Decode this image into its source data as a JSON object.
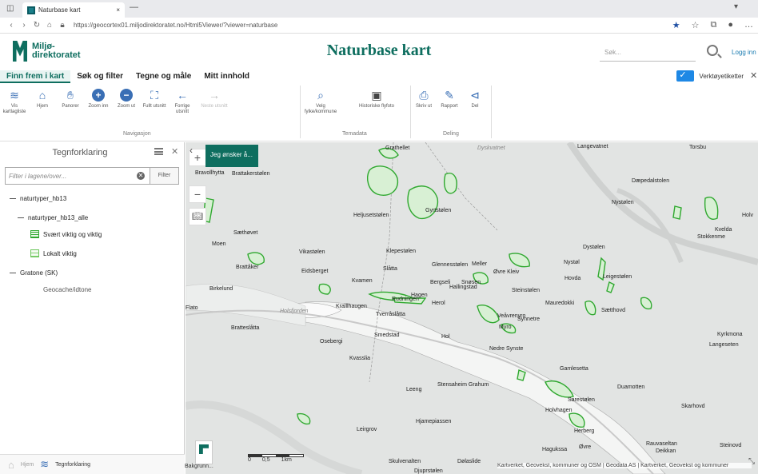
{
  "browser": {
    "tab_title": "Naturbase kart",
    "tab_close": "×",
    "new_tab": "—",
    "url": "https://geocortex01.miljodirektoratet.no/Html5Viewer/?viewer=naturbase"
  },
  "header": {
    "logo_line1": "Miljø-",
    "logo_line2": "direktoratet",
    "title": "Naturbase kart",
    "search_placeholder": "Søk...",
    "login": "Logg inn"
  },
  "ribbon_tabs": [
    {
      "label": "Finn frem i kart"
    },
    {
      "label": "Søk og filter"
    },
    {
      "label": "Tegne og måle"
    },
    {
      "label": "Mitt innhold"
    }
  ],
  "toggle_label": "Verktøyetiketter",
  "ribbon": {
    "navigation": [
      {
        "label": "Vis kartlagliste",
        "icon": "layers-icon"
      },
      {
        "label": "Hjem",
        "icon": "home-icon"
      },
      {
        "label": "Panorer",
        "icon": "pan-icon"
      },
      {
        "label": "Zoom inn",
        "icon": "zoom-in-icon"
      },
      {
        "label": "Zoom ut",
        "icon": "zoom-out-icon"
      },
      {
        "label": "Fullt utsnitt",
        "icon": "full-extent-icon"
      },
      {
        "label": "Forrige utsnitt",
        "icon": "previous-extent-icon"
      },
      {
        "label": "Neste utsnitt",
        "icon": "next-extent-icon"
      }
    ],
    "navigation_group": "Navigasjon",
    "tools": [
      {
        "label": "Velg fylke/kommune",
        "icon": "select-area-icon"
      },
      {
        "label": "Historiske flyfoto",
        "icon": "historic-photo-icon"
      }
    ],
    "tools_group": "Temadata",
    "share": [
      {
        "label": "Skriv ut",
        "icon": "print-icon"
      },
      {
        "label": "Rapport",
        "icon": "report-icon"
      },
      {
        "label": "Del",
        "icon": "share-icon"
      }
    ],
    "share_group": "Deling"
  },
  "panel": {
    "title": "Tegnforklaring",
    "filter_placeholder": "Filter i lagene/over...",
    "filter_button": "Filter",
    "tree": [
      {
        "label": "naturtyper_hb13"
      },
      {
        "label": "naturtyper_hb13_alle"
      },
      {
        "label": "Svært viktig og viktig"
      },
      {
        "label": "Lokalt viktig"
      },
      {
        "label": "Gratone (SK)"
      },
      {
        "label": "Geocache/idtone"
      }
    ],
    "footer": {
      "home": "Hjem",
      "legend": "Tegnforklaring"
    }
  },
  "map": {
    "cta": "Jeg ønsker å...",
    "basemap_label": "Bakgrunn...",
    "scale_labels": [
      "0",
      "0,5",
      "1km"
    ],
    "attribution": "Kartverket, Geovekst, kommuner og OSM | Geodata AS | Kartverket, Geovekst og kommuner",
    "places": [
      "Brattakerstølen",
      "Grathellet",
      "Dyskvatnet",
      "Langevatnet",
      "Torsbu",
      "Bravollhytta",
      "Gavlstølen",
      "Dæpedalstolen",
      "Nystølen",
      "Heljusetstølen",
      "Gyrtstølen",
      "Dystølen",
      "Stokkenme",
      "Kvelda",
      "Holv",
      "Sæthøvet",
      "Moen",
      "Vikastølen",
      "Klepestølen",
      "Glennesstølen",
      "Meller",
      "Brattåker",
      "Eidsberget",
      "Slåtta",
      "Kvamen",
      "Hallingstad",
      "Øvre Kleiv",
      "Nystøl",
      "Hovda",
      "Leigestølen",
      "Birkelund",
      "Bergseli",
      "Snøsen",
      "Rudningen",
      "Steinstølen",
      "Holsfjorden",
      "Kralllhaugen",
      "Herol",
      "Hagen",
      "Synnetre",
      "Mauredokki",
      "Sætthovd",
      "Flato",
      "Tverråslåtta",
      "Bratteslåtta",
      "Smedstad",
      "Myro",
      "Veåvrenyro",
      "Kyrkmona",
      "Langeseten",
      "Osebergi",
      "Hol",
      "Gamlesetta",
      "Nedre Synste",
      "Kvasslia",
      "Leeng",
      "Stensaheim Grahum",
      "Duamotten",
      "Sarestølen",
      "Skarhovd",
      "Hjamepiassen",
      "Holvhagen",
      "Leirgrov",
      "Rauvaseltan",
      "Steinovd",
      "Deikkan",
      "Skulvenalten",
      "Djuprstølen",
      "Dølaslide",
      "Hagukssa",
      "Øvre",
      "Herberg"
    ]
  },
  "colors": {
    "brand": "#0e6e5f",
    "accent": "#3a6fb5",
    "polygon_stroke": "#2fa82f",
    "polygon_fill": "#e9f7e9",
    "map_background": "#e2e4e3"
  }
}
